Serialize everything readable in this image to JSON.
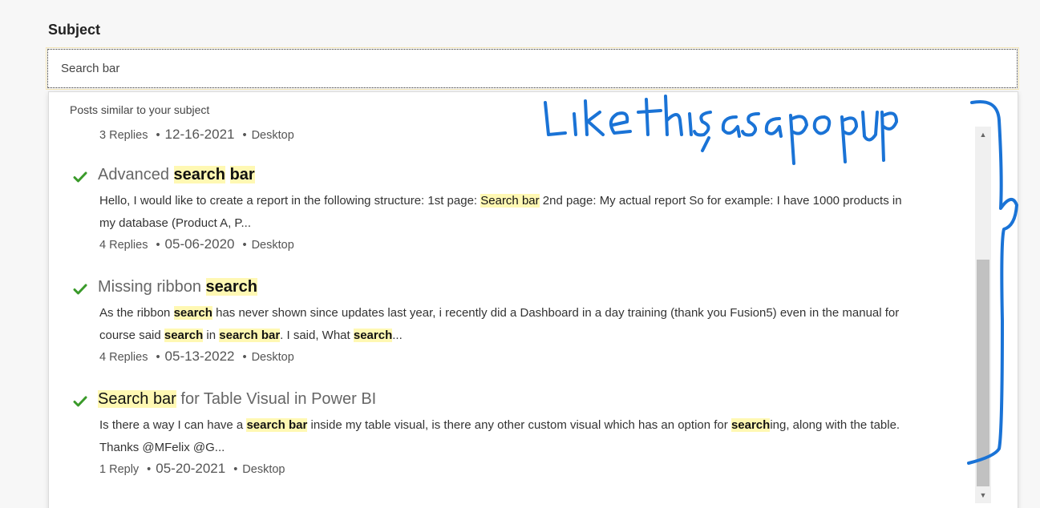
{
  "form": {
    "subject_label": "Subject",
    "search_value": "Search bar"
  },
  "dropdown": {
    "header": "Posts similar to your subject",
    "first_meta": {
      "replies": "3 Replies",
      "date": "12-16-2021",
      "category": "Desktop"
    },
    "results": [
      {
        "title_pre": "Advanced ",
        "title_hl1": "search",
        "title_mid": " ",
        "title_hl2": "bar",
        "title_post": "",
        "excerpt_line1_pre": "Hello,   I would like to create a report in the following structure: 1st page: ",
        "excerpt_hl": "Search bar",
        "excerpt_line1_post": " 2nd page: My actual report So for example: I have 1000 products in",
        "excerpt_line2": "my database (Product A, P...",
        "replies": "4 Replies",
        "date": "05-06-2020",
        "category": "Desktop"
      },
      {
        "title_pre": "Missing ribbon ",
        "title_hl1": "search",
        "excerpt_a": "As the ribbon ",
        "excerpt_hl_a": "search",
        "excerpt_b": " has never shown since updates last year, i recently did a Dashboard in a day training (thank you Fusion5) even in the manual for",
        "excerpt_c": "course said ",
        "excerpt_hl_c": "search",
        "excerpt_d": " in ",
        "excerpt_hl_d1": "search",
        "excerpt_d2": " ",
        "excerpt_hl_d2": "bar",
        "excerpt_e": ". I said, What ",
        "excerpt_hl_e": "search",
        "excerpt_f": "...",
        "replies": "4 Replies",
        "date": "05-13-2022",
        "category": "Desktop"
      },
      {
        "title_hl1": "Search",
        "title_mid": " ",
        "title_hl2": "bar",
        "title_post": " for Table Visual in Power BI",
        "excerpt_a": "Is there a way I can have a ",
        "excerpt_hl_a1": "search",
        "excerpt_a2": " ",
        "excerpt_hl_a2": "bar",
        "excerpt_b": " inside my table visual, is there any other custom visual which has an option for ",
        "excerpt_hl_b": "search",
        "excerpt_c": "ing, along with the table.",
        "excerpt_line2": "Thanks   @MFelix @G...",
        "replies": "1 Reply",
        "date": "05-20-2021",
        "category": "Desktop"
      }
    ],
    "dot": "•"
  },
  "scrollbar": {
    "up_glyph": "▲",
    "down_glyph": "▼"
  },
  "annotation": {
    "text": "Like this, as a pop up",
    "color": "#1a73d6"
  },
  "colors": {
    "highlight": "#fff8b3",
    "check": "#3a9a2a"
  }
}
